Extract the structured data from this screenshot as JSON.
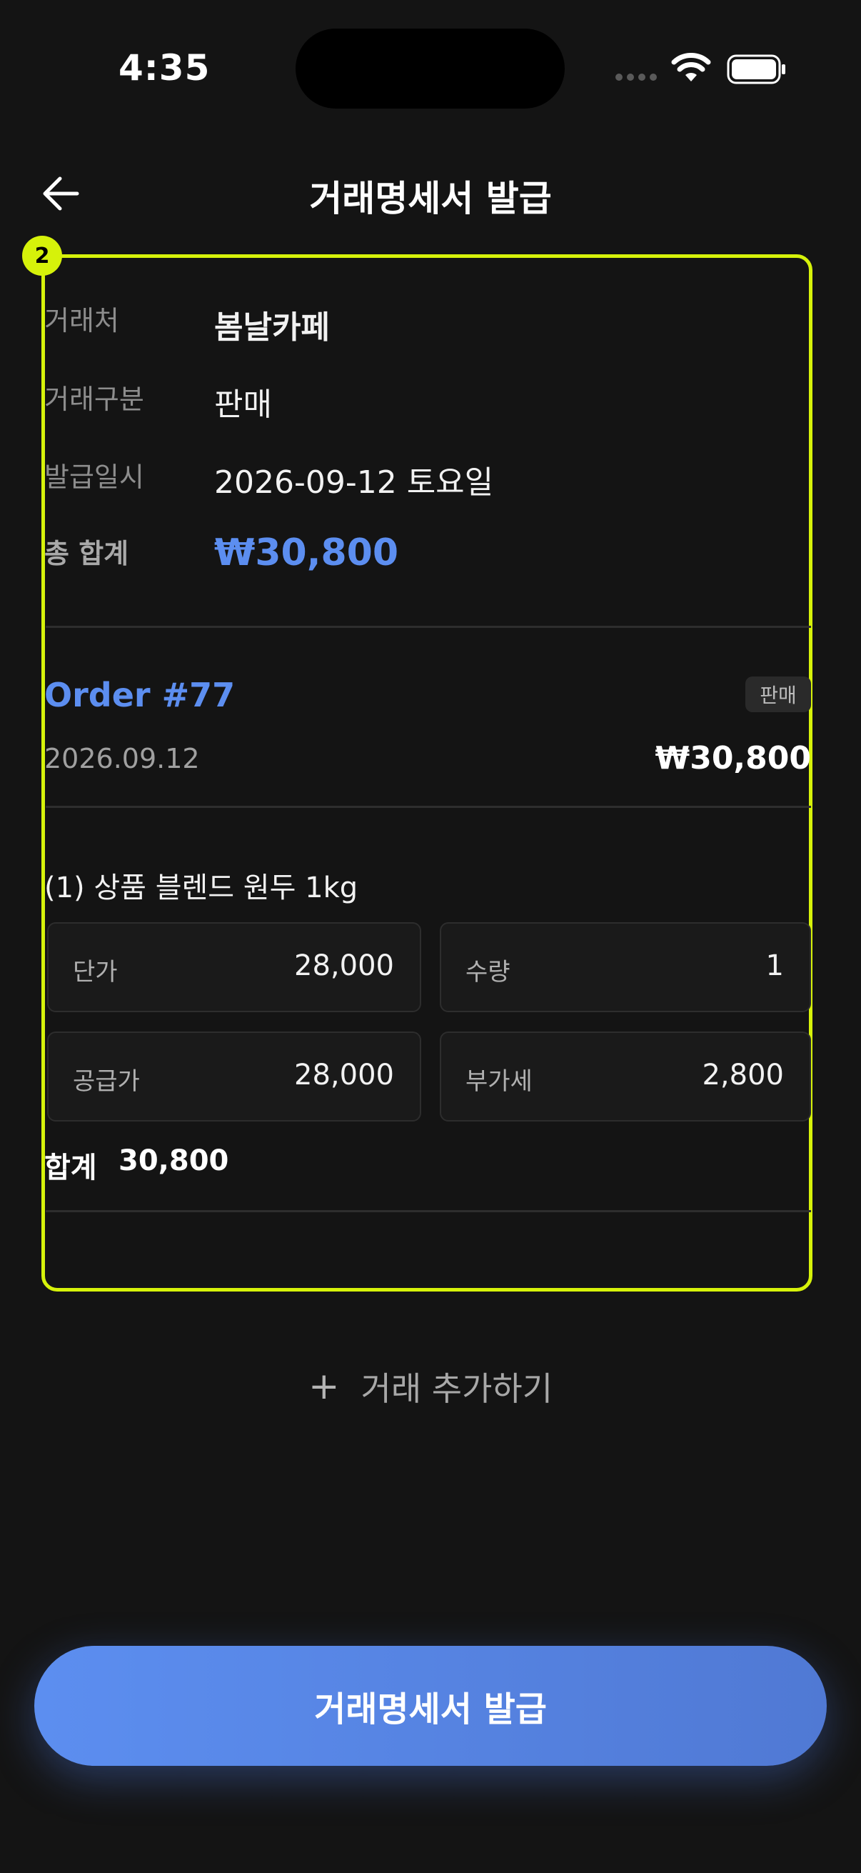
{
  "status_bar": {
    "time": "4:35"
  },
  "header": {
    "title": "거래명세서 발급"
  },
  "highlight": {
    "badge": "2"
  },
  "summary": {
    "client_label": "거래처",
    "client_value": "봄날카페",
    "type_label": "거래구분",
    "type_value": "판매",
    "date_label": "발급일시",
    "date_value": "2026-09-12 토요일",
    "total_label": "총 합계",
    "total_value": "₩30,800"
  },
  "order": {
    "title": "Order #77",
    "tag": "판매",
    "date": "2026.09.12",
    "amount": "₩30,800"
  },
  "item": {
    "name": "(1) 상품 블렌드 원두 1kg",
    "unit_price_label": "단가",
    "unit_price": "28,000",
    "qty_label": "수량",
    "qty": "1",
    "supply_label": "공급가",
    "supply": "28,000",
    "vat_label": "부가세",
    "vat": "2,800",
    "sum_label": "합계",
    "sum": "30,800"
  },
  "actions": {
    "add_label": "거래 추가하기",
    "issue_label": "거래명세서 발급"
  },
  "colors": {
    "accent": "#5c8ef0",
    "highlight": "#d6f20a",
    "background": "#141414"
  },
  "icons": [
    "back-arrow-icon",
    "wifi-icon",
    "battery-icon",
    "plus-icon",
    "signal-dots-icon"
  ]
}
